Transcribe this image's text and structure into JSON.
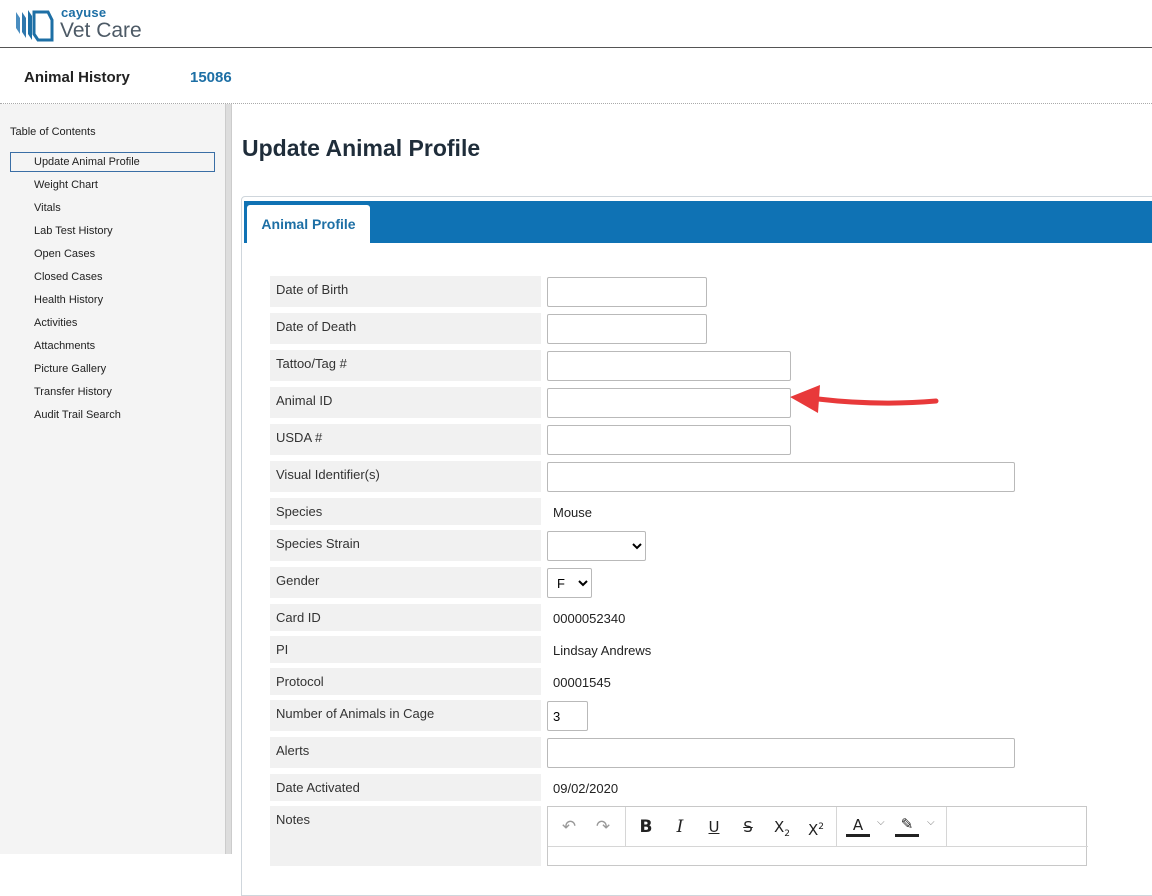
{
  "app": {
    "brand": "cayuse",
    "product": "Vet Care"
  },
  "subheader": {
    "title": "Animal History",
    "animal_id": "15086"
  },
  "sidebar": {
    "title": "Table of Contents",
    "items": [
      {
        "label": "Update Animal Profile",
        "active": true
      },
      {
        "label": "Weight Chart"
      },
      {
        "label": "Vitals"
      },
      {
        "label": "Lab Test History"
      },
      {
        "label": "Open Cases"
      },
      {
        "label": "Closed Cases"
      },
      {
        "label": "Health History"
      },
      {
        "label": "Activities"
      },
      {
        "label": "Attachments"
      },
      {
        "label": "Picture Gallery"
      },
      {
        "label": "Transfer History"
      },
      {
        "label": "Audit Trail Search"
      }
    ]
  },
  "main": {
    "title": "Update Animal Profile",
    "tab": "Animal Profile",
    "fields": {
      "date_of_birth": {
        "label": "Date of Birth",
        "value": ""
      },
      "date_of_death": {
        "label": "Date of Death",
        "value": ""
      },
      "tattoo": {
        "label": "Tattoo/Tag #",
        "value": ""
      },
      "animal_id": {
        "label": "Animal ID",
        "value": ""
      },
      "usda": {
        "label": "USDA #",
        "value": ""
      },
      "visual_identifiers": {
        "label": "Visual Identifier(s)",
        "value": ""
      },
      "species": {
        "label": "Species",
        "value": "Mouse"
      },
      "species_strain": {
        "label": "Species Strain",
        "value": ""
      },
      "gender": {
        "label": "Gender",
        "value": "F"
      },
      "card_id": {
        "label": "Card ID",
        "value": "0000052340"
      },
      "pi": {
        "label": "PI",
        "value": "Lindsay Andrews"
      },
      "protocol": {
        "label": "Protocol",
        "value": "00001545"
      },
      "num_animals": {
        "label": "Number of Animals in Cage",
        "value": "3"
      },
      "alerts": {
        "label": "Alerts",
        "value": ""
      },
      "date_activated": {
        "label": "Date Activated",
        "value": "09/02/2020"
      },
      "notes": {
        "label": "Notes"
      }
    }
  },
  "colors": {
    "accent": "#0f72b4",
    "link": "#1d6fa5",
    "arrow": "#e8393a"
  },
  "icons": [
    "undo-icon",
    "redo-icon",
    "bold-icon",
    "italic-icon",
    "underline-icon",
    "strikethrough-icon",
    "subscript-icon",
    "superscript-icon",
    "font-color-icon",
    "highlight-icon"
  ]
}
